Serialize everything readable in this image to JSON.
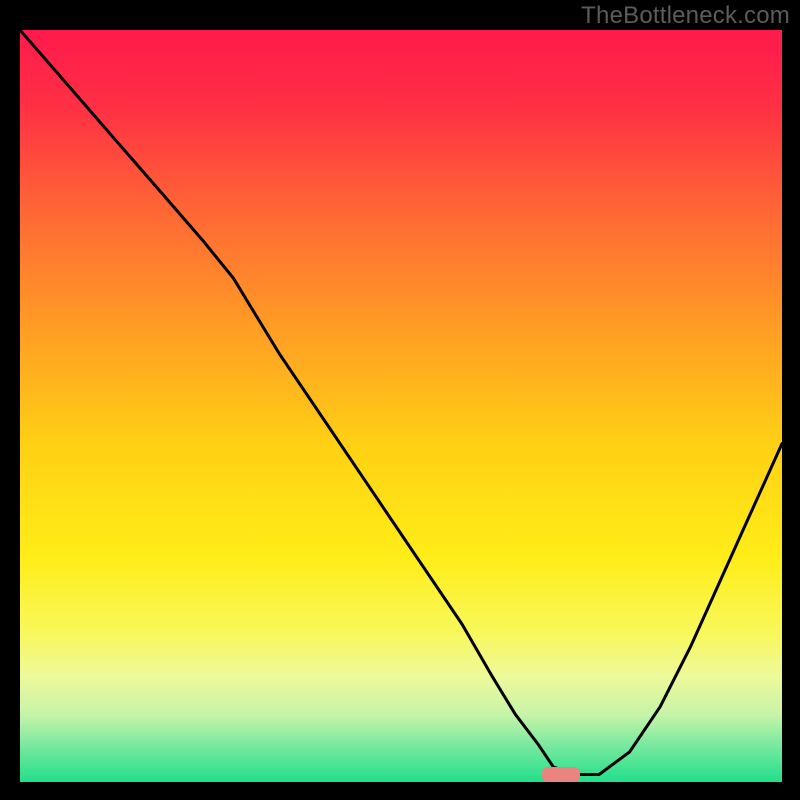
{
  "watermark": "TheBottleneck.com",
  "chart_data": {
    "type": "line",
    "title": "",
    "xlabel": "",
    "ylabel": "",
    "xlim": [
      0,
      100
    ],
    "ylim": [
      0,
      100
    ],
    "background_gradient": {
      "stops": [
        {
          "offset": 0.0,
          "color": "#ff1a4b"
        },
        {
          "offset": 0.1,
          "color": "#ff2f45"
        },
        {
          "offset": 0.25,
          "color": "#ff6a34"
        },
        {
          "offset": 0.4,
          "color": "#ff9e24"
        },
        {
          "offset": 0.55,
          "color": "#ffd014"
        },
        {
          "offset": 0.7,
          "color": "#ffed17"
        },
        {
          "offset": 0.8,
          "color": "#f8f85a"
        },
        {
          "offset": 0.86,
          "color": "#eef99a"
        },
        {
          "offset": 0.91,
          "color": "#c7f4a8"
        },
        {
          "offset": 0.95,
          "color": "#7be9a0"
        },
        {
          "offset": 1.0,
          "color": "#21df8a"
        }
      ]
    },
    "series": [
      {
        "name": "bottleneck-curve",
        "x": [
          0,
          6,
          12,
          18,
          24,
          28,
          34,
          40,
          46,
          52,
          58,
          62,
          65,
          68,
          70,
          73,
          76,
          80,
          84,
          88,
          92,
          96,
          100
        ],
        "y": [
          100,
          93,
          86,
          79,
          72,
          67,
          57,
          48,
          39,
          30,
          21,
          14,
          9,
          5,
          2,
          1,
          1,
          4,
          10,
          18,
          27,
          36,
          45
        ]
      }
    ],
    "marker": {
      "name": "optimal-point",
      "x": 71,
      "y": 1,
      "width": 5,
      "height": 2,
      "color": "#e9847f"
    }
  }
}
